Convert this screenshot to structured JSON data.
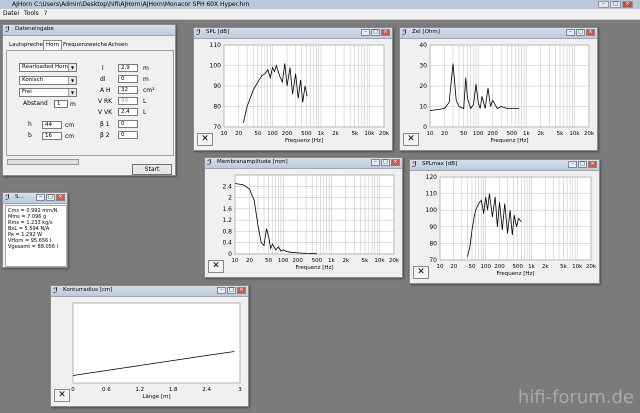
{
  "app": {
    "title": "AJHorn  C:\\Users\\Admin\\Desktop\\hifi\\AJHorn\\AJHorn\\Monacor SPH 60X Hyper.hrn",
    "menu": [
      "Datei",
      "Tools",
      "?"
    ]
  },
  "input_window": {
    "title": "Dateneingabe",
    "tabs": [
      "Lautsprecher",
      "Horn",
      "Frequenzweiche",
      "Achsen"
    ],
    "active_tab": "Horn",
    "combos": [
      "Rearloaded Horn",
      "Konisch",
      "Frei"
    ],
    "abstand_label": "Abstand",
    "abstand_value": "1",
    "abstand_unit": "m",
    "h_label": "h",
    "h_value": "44",
    "h_unit": "cm",
    "b_label": "b",
    "b_value": "16",
    "b_unit": "cm",
    "params": [
      {
        "label": "l",
        "value": "2,9",
        "unit": "m"
      },
      {
        "label": "dl",
        "value": "0",
        "unit": "m"
      },
      {
        "label": "A H",
        "value": "32",
        "unit": "cm²"
      },
      {
        "label": "V RK",
        "value": "30",
        "unit": "L"
      },
      {
        "label": "V VK",
        "value": "2,4",
        "unit": "L"
      },
      {
        "label": "β 1",
        "value": "0",
        "unit": ""
      },
      {
        "label": "β 2",
        "value": "0",
        "unit": ""
      }
    ],
    "start_button": "Start"
  },
  "stats_window": {
    "title": "S...",
    "lines": [
      "Cms = 0.992 mm/N",
      "Mms = 7.096 g",
      "Rms = 1.233 kg/s",
      "BxL = 5.594 N/A",
      "Pe = 1.292 W",
      "VHorn = 95.656 l",
      "Vgesamt = 88.056 l"
    ]
  },
  "charts": {
    "spl": {
      "title": "SPL [dB]",
      "xlabel": "Frequenz [Hz]",
      "xticks": [
        "10",
        "20",
        "50",
        "100",
        "200",
        "500",
        "1k",
        "2k",
        "5k",
        "10k",
        "20k"
      ],
      "yticks": [
        "70",
        "80",
        "90",
        "100",
        "110"
      ]
    },
    "zel": {
      "title": "Zel [Ohm]",
      "xlabel": "Frequenz [Hz]",
      "xticks": [
        "10",
        "20",
        "50",
        "100",
        "200",
        "500",
        "1k",
        "2k",
        "5k",
        "10k",
        "20k"
      ],
      "yticks": [
        "0",
        "10",
        "20",
        "30",
        "40"
      ]
    },
    "membrane": {
      "title": "Membranamplitude [mm]",
      "xlabel": "Frequenz [Hz]",
      "xticks": [
        "10",
        "20",
        "50",
        "100",
        "200",
        "500",
        "1k",
        "2k",
        "5k",
        "10k",
        "20k"
      ],
      "yticks": [
        "0",
        "0.4",
        "0.8",
        "1.2",
        "1.6",
        "2",
        "2.4"
      ]
    },
    "splmax": {
      "title": "SPLmax [dB]",
      "xlabel": "Frequenz [Hz]",
      "xticks": [
        "10",
        "20",
        "50",
        "100",
        "200",
        "500",
        "1k",
        "2k",
        "5k",
        "10k",
        "20k"
      ],
      "yticks": [
        "70",
        "80",
        "90",
        "100",
        "110",
        "120"
      ]
    },
    "kontur": {
      "title": "Konturradius [cm]",
      "xlabel": "Länge [m]",
      "xticks": [
        "0",
        "0.6",
        "1.2",
        "1.8",
        "2.4",
        "3"
      ]
    }
  },
  "chart_data": [
    {
      "type": "line",
      "title": "SPL [dB]",
      "xlabel": "Frequenz [Hz]",
      "x_scale": "log",
      "xlim": [
        10,
        20000
      ],
      "ylim": [
        70,
        110
      ],
      "series": [
        {
          "x": [
            25,
            30,
            40,
            50,
            60,
            70,
            80,
            90,
            100,
            110,
            120,
            140,
            160,
            180,
            200,
            230,
            260,
            300,
            340,
            380,
            420,
            470,
            520
          ],
          "y": [
            72,
            80,
            88,
            92,
            95,
            96,
            98,
            94,
            99,
            97,
            100,
            95,
            92,
            101,
            90,
            99,
            86,
            96,
            84,
            93,
            82,
            90,
            85
          ]
        }
      ]
    },
    {
      "type": "line",
      "title": "Zel [Ohm]",
      "xlabel": "Frequenz [Hz]",
      "x_scale": "log",
      "xlim": [
        10,
        20000
      ],
      "ylim": [
        0,
        40
      ],
      "series": [
        {
          "x": [
            10,
            20,
            25,
            30,
            35,
            40,
            50,
            55,
            60,
            70,
            80,
            90,
            100,
            110,
            120,
            140,
            160,
            180,
            200,
            250,
            300,
            400,
            500,
            700
          ],
          "y": [
            8,
            9,
            12,
            31,
            13,
            10,
            9,
            24,
            14,
            9,
            11,
            21,
            12,
            9,
            15,
            9,
            19,
            10,
            13,
            9,
            10,
            9,
            9,
            9
          ]
        }
      ]
    },
    {
      "type": "line",
      "title": "Membranamplitude [mm]",
      "xlabel": "Frequenz [Hz]",
      "x_scale": "log",
      "xlim": [
        10,
        20000
      ],
      "ylim": [
        0,
        2.8
      ],
      "series": [
        {
          "x": [
            10,
            15,
            20,
            25,
            30,
            35,
            40,
            45,
            50,
            55,
            60,
            70,
            80,
            90,
            100,
            120,
            150,
            200,
            300,
            500
          ],
          "y": [
            2.5,
            2.45,
            2.3,
            1.9,
            1.0,
            0.4,
            0.3,
            0.9,
            0.6,
            0.2,
            0.35,
            0.15,
            0.25,
            0.1,
            0.15,
            0.08,
            0.06,
            0.04,
            0.02,
            0.01
          ]
        }
      ]
    },
    {
      "type": "line",
      "title": "SPLmax [dB]",
      "xlabel": "Frequenz [Hz]",
      "x_scale": "log",
      "xlim": [
        10,
        20000
      ],
      "ylim": [
        70,
        120
      ],
      "series": [
        {
          "x": [
            40,
            45,
            50,
            55,
            60,
            70,
            80,
            90,
            100,
            110,
            120,
            140,
            160,
            180,
            200,
            230,
            260,
            300,
            340,
            380,
            420,
            470,
            520,
            600
          ],
          "y": [
            72,
            78,
            88,
            95,
            100,
            104,
            106,
            98,
            108,
            100,
            110,
            96,
            108,
            90,
            105,
            88,
            104,
            86,
            100,
            85,
            97,
            90,
            95,
            93
          ]
        }
      ]
    },
    {
      "type": "line",
      "title": "Konturradius [cm]",
      "xlabel": "Länge [m]",
      "xlim": [
        0,
        3
      ],
      "series": [
        {
          "x": [
            0,
            0.6,
            1.2,
            1.8,
            2.4,
            2.9
          ],
          "y": [
            1.5,
            2.5,
            3.5,
            4.5,
            5.5,
            6.3
          ]
        }
      ]
    }
  ],
  "watermark": "hifi-forum.de"
}
